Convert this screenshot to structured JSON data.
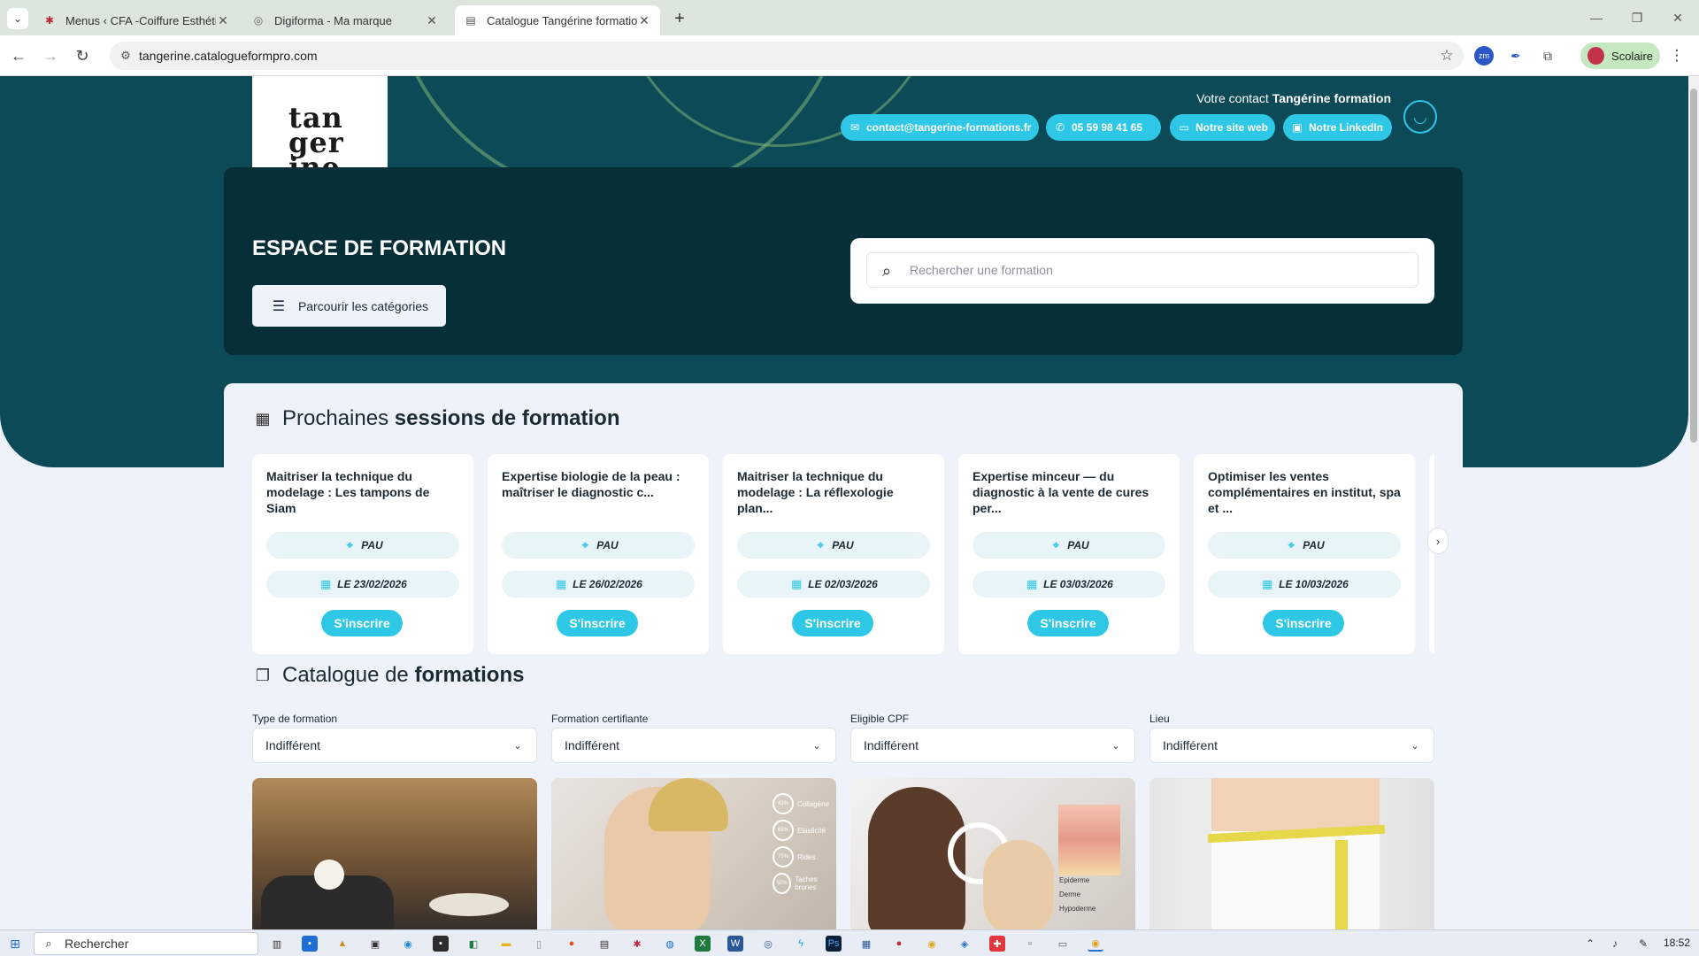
{
  "browser": {
    "tabs": [
      {
        "title": "Menus ‹ CFA -Coiffure Esthétiq",
        "icon": "maple-leaf-icon",
        "active": false
      },
      {
        "title": "Digiforma - Ma marque",
        "icon": "globe-icon",
        "active": false
      },
      {
        "title": "Catalogue Tangérine formation",
        "icon": "page-icon",
        "active": true
      }
    ],
    "url": "tangerine.catalogueformpro.com",
    "profile_label": "Scolaire",
    "colors": {
      "tabbar": "#dce6dd",
      "profile": "#c5e8c0"
    }
  },
  "header": {
    "logo_lines": [
      "tan",
      "ger",
      "ine."
    ],
    "contact_title_prefix": "Votre contact ",
    "contact_title_brand": "Tangérine formation",
    "buttons": {
      "email": "contact@tangerine-formations.fr",
      "phone": "05 59 98 41 65",
      "website": "Notre site web",
      "linkedin": "Notre LinkedIn"
    }
  },
  "hero": {
    "title": "ESPACE DE FORMATION",
    "browse_label": "Parcourir les catégories",
    "search_placeholder": "Rechercher une formation"
  },
  "sessions": {
    "title_plain": "Prochaines ",
    "title_bold": "sessions de formation",
    "cta_label": "S'inscrire",
    "items": [
      {
        "title": "Maitriser la technique du modelage : Les tampons de Siam",
        "location": "PAU",
        "date": "LE 23/02/2026"
      },
      {
        "title": "Expertise biologie de la peau : maîtriser le diagnostic c...",
        "location": "PAU",
        "date": "LE 26/02/2026"
      },
      {
        "title": "Maitriser la technique du modelage : La réflexologie plan...",
        "location": "PAU",
        "date": "LE 02/03/2026"
      },
      {
        "title": "Expertise minceur — du diagnostic à la vente de cures per...",
        "location": "PAU",
        "date": "LE 03/03/2026"
      },
      {
        "title": "Optimiser les ventes complémentaires en institut, spa et ...",
        "location": "PAU",
        "date": "LE 10/03/2026"
      }
    ]
  },
  "catalogue": {
    "title_plain": "Catalogue de ",
    "title_bold": "formations",
    "filters": [
      {
        "label": "Type de formation",
        "value": "Indifférent"
      },
      {
        "label": "Formation certifiante",
        "value": "Indifférent"
      },
      {
        "label": "Eligible CPF",
        "value": "Indifférent"
      },
      {
        "label": "Lieu",
        "value": "Indifférent"
      }
    ],
    "thumb2_stats": [
      {
        "value": "43%",
        "label": "Collagène"
      },
      {
        "value": "65%",
        "label": "Elasticité"
      },
      {
        "value": "75%",
        "label": "Rides"
      },
      {
        "value": "50%",
        "label": "Taches brunes"
      }
    ],
    "thumb3_layers": [
      "Epiderme",
      "Derme",
      "Hypoderme"
    ]
  },
  "taskbar": {
    "search_label": "Rechercher",
    "time": "18:52"
  },
  "colors": {
    "hero_bg": "#0d4a57",
    "panel_dark": "#062f38",
    "accent": "#2ec8e6",
    "page_bg": "#eef2fb"
  }
}
